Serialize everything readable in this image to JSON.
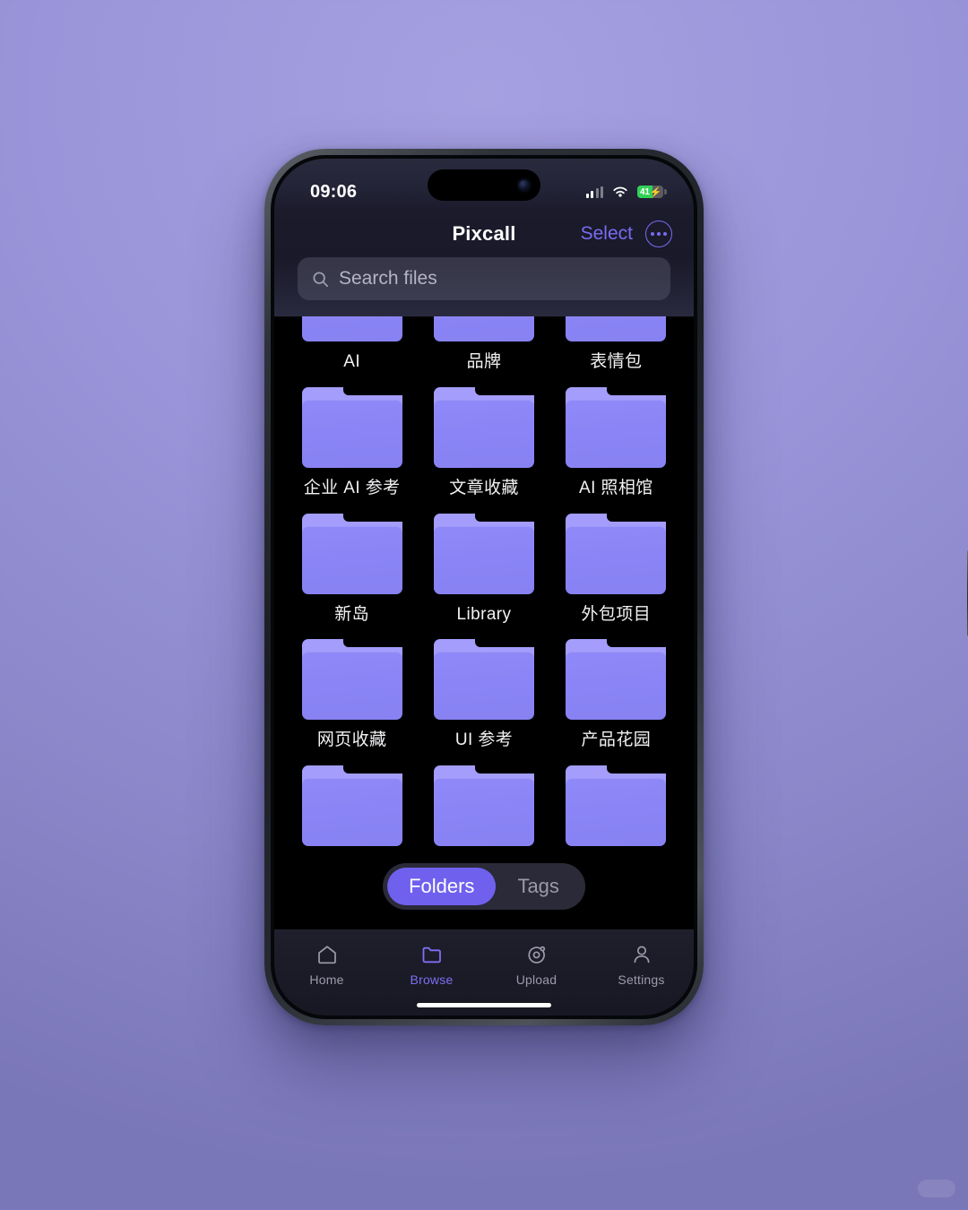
{
  "status_bar": {
    "time": "09:06",
    "signal_icon": "cellular-signal-icon",
    "wifi_icon": "wifi-icon",
    "battery_level": "41",
    "battery_charging_glyph": "⚡",
    "battery_color": "#32d156"
  },
  "nav": {
    "title": "Pixcall",
    "select_label": "Select",
    "more_icon": "more-ellipsis-icon",
    "accent_color": "#7a6bf2"
  },
  "search": {
    "placeholder": "Search files",
    "icon": "search-icon"
  },
  "grid": {
    "folder_color": "#8a84f6",
    "rows": [
      {
        "items": [
          {
            "label": "AI"
          },
          {
            "label": "品牌"
          },
          {
            "label": "表情包"
          }
        ]
      },
      {
        "items": [
          {
            "label": "企业 AI 参考"
          },
          {
            "label": "文章收藏"
          },
          {
            "label": "AI 照相馆"
          }
        ]
      },
      {
        "items": [
          {
            "label": "新岛"
          },
          {
            "label": "Library"
          },
          {
            "label": "外包项目"
          }
        ]
      },
      {
        "items": [
          {
            "label": "网页收藏"
          },
          {
            "label": "UI 参考"
          },
          {
            "label": "产品花园"
          }
        ]
      },
      {
        "items": [
          {
            "label": ""
          },
          {
            "label": ""
          },
          {
            "label": ""
          }
        ]
      }
    ]
  },
  "segmented": {
    "options": [
      {
        "label": "Folders",
        "active": true
      },
      {
        "label": "Tags",
        "active": false
      }
    ],
    "active_color": "#6f61ee"
  },
  "tab_bar": {
    "tabs": [
      {
        "label": "Home",
        "icon": "home-icon",
        "active": false
      },
      {
        "label": "Browse",
        "icon": "folder-icon",
        "active": true
      },
      {
        "label": "Upload",
        "icon": "upload-orbit-icon",
        "active": false
      },
      {
        "label": "Settings",
        "icon": "person-icon",
        "active": false
      }
    ],
    "active_color": "#7e6ff3"
  },
  "watermark": {
    "label": ""
  }
}
